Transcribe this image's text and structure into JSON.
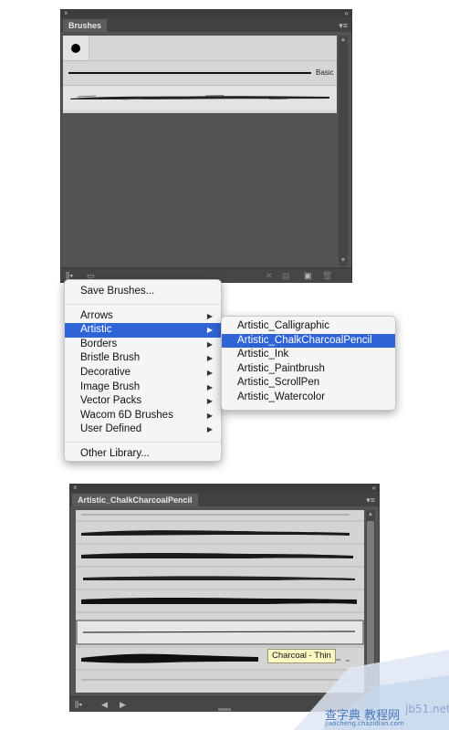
{
  "brushes_panel": {
    "close_glyph": "×",
    "collapse_glyph": "«",
    "tab_label": "Brushes",
    "menu_glyph": "▾≡",
    "brushes": [
      {
        "type": "dot"
      },
      {
        "type": "line",
        "label": "Basic"
      },
      {
        "type": "chalk",
        "selected": true
      }
    ],
    "toolbar_icons": [
      "library-icon",
      "brush-options-icon",
      "remove-stroke-icon",
      "options-icon",
      "new-brush-icon",
      "delete-icon"
    ]
  },
  "library_menu": {
    "save_label": "Save Brushes...",
    "items": [
      {
        "label": "Arrows",
        "submenu": true
      },
      {
        "label": "Artistic",
        "submenu": true,
        "selected": true
      },
      {
        "label": "Borders",
        "submenu": true
      },
      {
        "label": "Bristle Brush",
        "submenu": true
      },
      {
        "label": "Decorative",
        "submenu": true
      },
      {
        "label": "Image Brush",
        "submenu": true
      },
      {
        "label": "Vector Packs",
        "submenu": true
      },
      {
        "label": "Wacom 6D Brushes",
        "submenu": true
      },
      {
        "label": "User Defined",
        "submenu": true
      }
    ],
    "other_library_label": "Other Library...",
    "arrow_glyph": "▶"
  },
  "artistic_submenu": {
    "items": [
      {
        "label": "Artistic_Calligraphic"
      },
      {
        "label": "Artistic_ChalkCharcoalPencil",
        "selected": true
      },
      {
        "label": "Artistic_Ink"
      },
      {
        "label": "Artistic_Paintbrush"
      },
      {
        "label": "Artistic_ScrollPen"
      },
      {
        "label": "Artistic_Watercolor"
      }
    ]
  },
  "library_panel": {
    "close_glyph": "×",
    "collapse_glyph": "«",
    "tab_label": "Artistic_ChalkCharcoalPencil",
    "menu_glyph": "▾≡",
    "tooltip": "Charcoal - Thin",
    "row_count": 8,
    "selected_row": 5,
    "nav_prev": "◀",
    "nav_next": "▶"
  },
  "watermark": {
    "line1": "查字典 教程网",
    "line2": "jiaocheng.chazidian.com",
    "corner": "jb51.net"
  },
  "colors": {
    "panel_bg": "#535353",
    "list_bg": "#d6d6d6",
    "menu_highlight": "#2f64d6",
    "tooltip_bg": "#fbf7c2"
  }
}
